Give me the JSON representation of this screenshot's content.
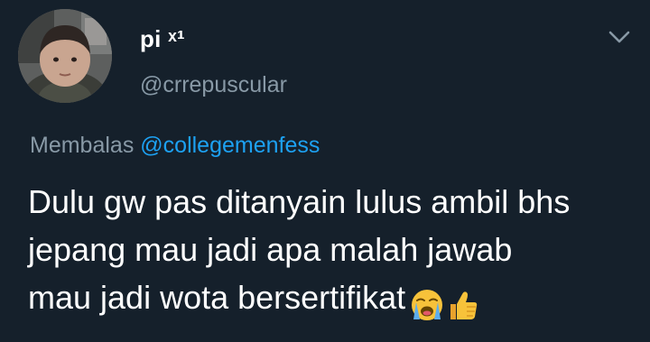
{
  "tweet": {
    "display_name": "pi ˣ¹",
    "username": "@crrepuscular",
    "reply_prefix": "Membalas",
    "reply_handle": "@collegemenfess",
    "text": "Dulu gw pas ditanyain lulus ambil bhs\njepang mau jadi apa malah jawab\nmau jadi wota bersertifikat"
  },
  "icons": {
    "menu": "chevron-down-icon",
    "emoji_1": "loudly-crying-face-emoji",
    "emoji_2": "thumbs-up-emoji"
  },
  "colors": {
    "background": "#15202b",
    "primary_text": "#ffffff",
    "secondary_text": "#8899a6",
    "link": "#1da1f2"
  }
}
